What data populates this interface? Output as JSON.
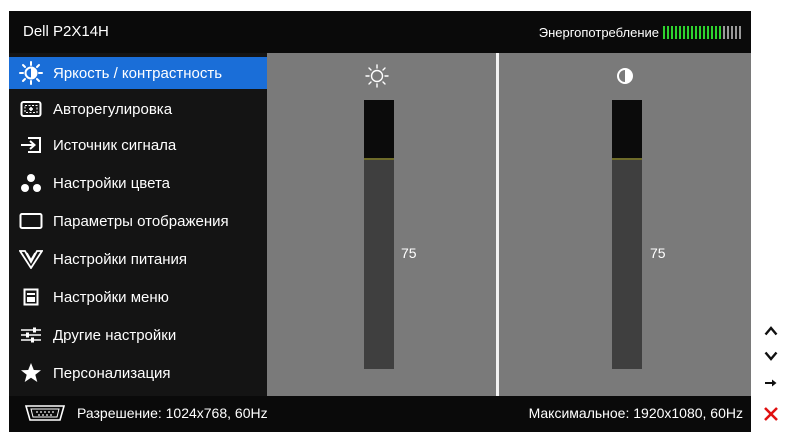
{
  "header": {
    "model": "Dell P2X14H",
    "power_label": "Энергопотребление",
    "power_ticks_total": 20,
    "power_ticks_lit": 15,
    "power_lit_color": "#2fd32f",
    "power_dim_color": "#9a9a9a"
  },
  "menu": {
    "selected_color": "#1a6ed8",
    "items": [
      {
        "label": "Яркость / контрастность",
        "icon": "brightness-contrast-icon",
        "selected": true
      },
      {
        "label": "Авторегулировка",
        "icon": "auto-adjust-icon",
        "selected": false
      },
      {
        "label": "Источник сигнала",
        "icon": "input-source-icon",
        "selected": false
      },
      {
        "label": "Настройки цвета",
        "icon": "color-settings-icon",
        "selected": false
      },
      {
        "label": "Параметры отображения",
        "icon": "display-settings-icon",
        "selected": false
      },
      {
        "label": "Настройки питания",
        "icon": "power-settings-icon",
        "selected": false
      },
      {
        "label": "Настройки меню",
        "icon": "menu-settings-icon",
        "selected": false
      },
      {
        "label": "Другие настройки",
        "icon": "other-settings-icon",
        "selected": false
      },
      {
        "label": "Персонализация",
        "icon": "star-icon",
        "selected": false
      }
    ]
  },
  "brightness": {
    "icon": "sun-icon",
    "value": "75"
  },
  "contrast": {
    "icon": "contrast-icon",
    "value": "75"
  },
  "footer": {
    "resolution": "Разрешение: 1024x768, 60Hz",
    "max_resolution": "Максимальное: 1920x1080, 60Hz"
  },
  "nav": {
    "up_icon": "chevron-up-icon",
    "down_icon": "chevron-down-icon",
    "enter_icon": "arrow-right-icon",
    "exit_icon": "close-icon",
    "exit_color": "#e01010"
  }
}
